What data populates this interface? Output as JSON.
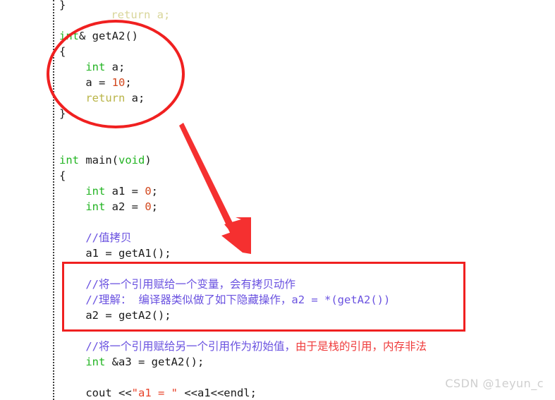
{
  "document": {
    "type": "code-screenshot",
    "language": "cpp",
    "background_color": "#ffffff"
  },
  "colors": {
    "keyword": "#22b422",
    "number": "#d2481e",
    "return_keyword": "#b9b447",
    "string": "#e8432a",
    "comment": "#6a52e0",
    "comment_red": "#ef3b3b",
    "plain": "#1a1a1a",
    "annotation_red": "#f02020",
    "guide_line": "#3d3d3d",
    "watermark": "#cfcfcf"
  },
  "clipped_top_line": "return a;",
  "code_lines": [
    {
      "id": "l01",
      "indent": 0,
      "segments": [
        {
          "text": "}",
          "cls": "tok-plain"
        }
      ]
    },
    {
      "id": "l02",
      "indent": 0,
      "segments": []
    },
    {
      "id": "l03",
      "indent": 0,
      "segments": [
        {
          "text": "int",
          "cls": "tok-kw"
        },
        {
          "text": "& getA2()",
          "cls": "tok-plain"
        }
      ]
    },
    {
      "id": "l04",
      "indent": 0,
      "segments": [
        {
          "text": "{",
          "cls": "tok-plain"
        }
      ]
    },
    {
      "id": "l05",
      "indent": 1,
      "segments": [
        {
          "text": "int",
          "cls": "tok-kw"
        },
        {
          "text": " a;",
          "cls": "tok-plain"
        }
      ]
    },
    {
      "id": "l06",
      "indent": 1,
      "segments": [
        {
          "text": "a = ",
          "cls": "tok-plain"
        },
        {
          "text": "10",
          "cls": "tok-num"
        },
        {
          "text": ";",
          "cls": "tok-plain"
        }
      ]
    },
    {
      "id": "l07",
      "indent": 1,
      "segments": [
        {
          "text": "return",
          "cls": "tok-ret"
        },
        {
          "text": " a;",
          "cls": "tok-plain"
        }
      ]
    },
    {
      "id": "l08",
      "indent": 0,
      "segments": [
        {
          "text": "}",
          "cls": "tok-plain"
        }
      ]
    },
    {
      "id": "l09",
      "indent": 0,
      "segments": []
    },
    {
      "id": "l10",
      "indent": 0,
      "segments": []
    },
    {
      "id": "l11",
      "indent": 0,
      "segments": [
        {
          "text": "int",
          "cls": "tok-kw"
        },
        {
          "text": " main(",
          "cls": "tok-plain"
        },
        {
          "text": "void",
          "cls": "tok-kw"
        },
        {
          "text": ")",
          "cls": "tok-plain"
        }
      ]
    },
    {
      "id": "l12",
      "indent": 0,
      "segments": [
        {
          "text": "{",
          "cls": "tok-plain"
        }
      ]
    },
    {
      "id": "l13",
      "indent": 1,
      "segments": [
        {
          "text": "int",
          "cls": "tok-kw"
        },
        {
          "text": " a1 = ",
          "cls": "tok-plain"
        },
        {
          "text": "0",
          "cls": "tok-num"
        },
        {
          "text": ";",
          "cls": "tok-plain"
        }
      ]
    },
    {
      "id": "l14",
      "indent": 1,
      "segments": [
        {
          "text": "int",
          "cls": "tok-kw"
        },
        {
          "text": " a2 = ",
          "cls": "tok-plain"
        },
        {
          "text": "0",
          "cls": "tok-num"
        },
        {
          "text": ";",
          "cls": "tok-plain"
        }
      ]
    },
    {
      "id": "l15",
      "indent": 0,
      "segments": []
    },
    {
      "id": "l16",
      "indent": 1,
      "segments": [
        {
          "text": "//",
          "cls": "tok-comment"
        },
        {
          "text": "值拷贝",
          "cls": "tok-comment cjk"
        }
      ]
    },
    {
      "id": "l17",
      "indent": 1,
      "segments": [
        {
          "text": "a1 = getA1();",
          "cls": "tok-plain"
        }
      ]
    },
    {
      "id": "l18",
      "indent": 0,
      "segments": []
    },
    {
      "id": "l19",
      "indent": 1,
      "segments": [
        {
          "text": "//",
          "cls": "tok-comment"
        },
        {
          "text": "将一个引用赋给一个变量，会有拷贝动作",
          "cls": "tok-comment cjk"
        }
      ]
    },
    {
      "id": "l20",
      "indent": 1,
      "segments": [
        {
          "text": "//",
          "cls": "tok-comment"
        },
        {
          "text": "理解：  编译器类似做了如下隐藏操作，",
          "cls": "tok-comment cjk"
        },
        {
          "text": "a2 = *(getA2())",
          "cls": "tok-comment"
        }
      ]
    },
    {
      "id": "l21",
      "indent": 1,
      "segments": [
        {
          "text": "a2 = getA2();",
          "cls": "tok-plain"
        }
      ]
    },
    {
      "id": "l22",
      "indent": 0,
      "segments": []
    },
    {
      "id": "l23",
      "indent": 1,
      "segments": [
        {
          "text": "//",
          "cls": "tok-comment"
        },
        {
          "text": "将一个引用赋给另一个引用作为初始值，",
          "cls": "tok-comment cjk"
        },
        {
          "text": "由于是栈的引用，内存非法",
          "cls": "tok-red cjk"
        }
      ]
    },
    {
      "id": "l24",
      "indent": 1,
      "segments": [
        {
          "text": "int",
          "cls": "tok-kw"
        },
        {
          "text": " &a3 = getA2();",
          "cls": "tok-plain"
        }
      ]
    },
    {
      "id": "l25",
      "indent": 0,
      "segments": []
    },
    {
      "id": "l26",
      "indent": 1,
      "segments": [
        {
          "text": "cout <<",
          "cls": "tok-plain"
        },
        {
          "text": "\"a1 = \"",
          "cls": "tok-str"
        },
        {
          "text": " <<a1<<endl;",
          "cls": "tok-plain"
        }
      ]
    }
  ],
  "annotations": {
    "ellipse": {
      "label": "red-ellipse-highlight",
      "encircles": "int& getA2() function body returning reference to local variable"
    },
    "arrow": {
      "label": "red-arrow",
      "points_from": "getA2 function definition",
      "points_to": "a2 = getA2(); assignment block"
    },
    "rectangle": {
      "label": "red-rectangle-highlight",
      "encloses": "comment block explaining reference-to-variable copy and a2 = getA2();"
    }
  },
  "watermark": {
    "text": "CSDN @1eyun_c"
  }
}
